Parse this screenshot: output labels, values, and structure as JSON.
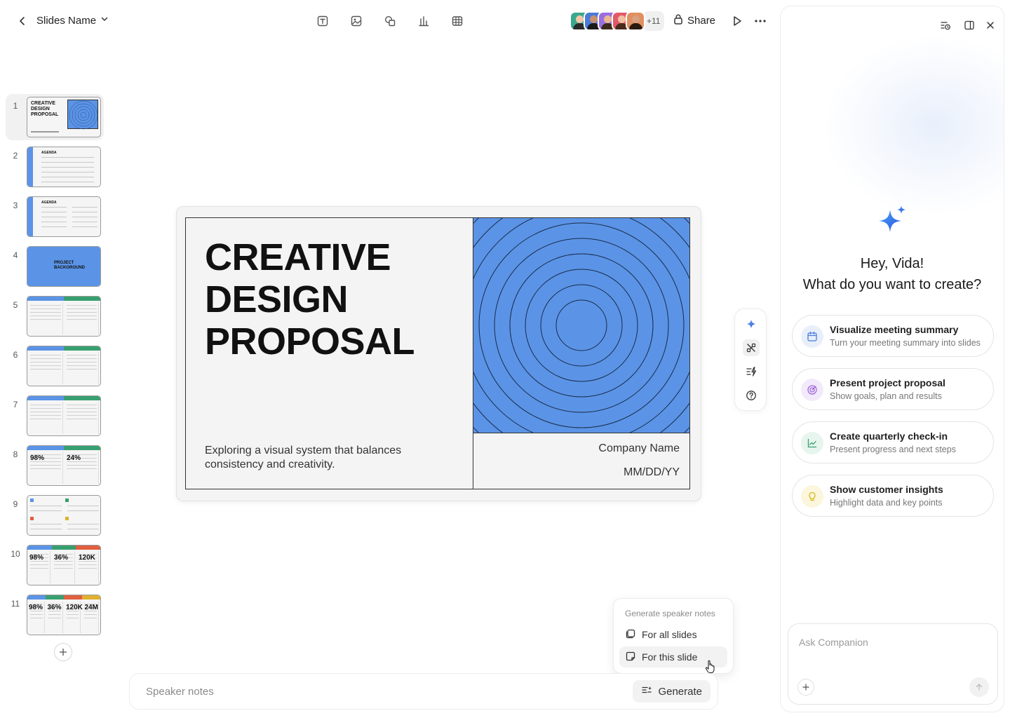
{
  "header": {
    "slides_name": "Slides Name",
    "extra_collaborators": "+11",
    "share_label": "Share",
    "avatar_colors": [
      "#3aa88c",
      "#4a7bd8",
      "#9a6ee0",
      "#e05a6a",
      "#e09060"
    ]
  },
  "toolbar": {
    "icons": [
      "text-box-icon",
      "image-icon",
      "shapes-icon",
      "chart-icon",
      "table-icon"
    ]
  },
  "slides": [
    {
      "num": "1",
      "kind": "title",
      "title": "CREATIVE DESIGN PROPOSAL"
    },
    {
      "num": "2",
      "kind": "agenda",
      "title": "AGENDA"
    },
    {
      "num": "3",
      "kind": "agenda2",
      "title": "AGENDA"
    },
    {
      "num": "4",
      "kind": "background",
      "title": "PROJECT BACKGROUND"
    },
    {
      "num": "5",
      "kind": "two-col"
    },
    {
      "num": "6",
      "kind": "two-col"
    },
    {
      "num": "7",
      "kind": "two-col"
    },
    {
      "num": "8",
      "kind": "stats2",
      "values": [
        "98%",
        "24%"
      ]
    },
    {
      "num": "9",
      "kind": "quad"
    },
    {
      "num": "10",
      "kind": "stats3",
      "values": [
        "98%",
        "36%",
        "120K"
      ]
    },
    {
      "num": "11",
      "kind": "stats4",
      "values": [
        "98%",
        "36%",
        "120K",
        "24M"
      ]
    }
  ],
  "main_slide": {
    "title_lines": [
      "CREATIVE",
      "DESIGN",
      "PROPOSAL"
    ],
    "subtitle": "Exploring a visual system that balances consistency and creativity.",
    "company": "Company Name",
    "date": "MM/DD/YY",
    "accent_color": "#5b94e6"
  },
  "notes": {
    "placeholder": "Speaker notes",
    "generate_label": "Generate"
  },
  "notes_menu": {
    "header": "Generate speaker notes",
    "for_all": "For all slides",
    "for_this": "For this slide"
  },
  "companion": {
    "greeting": "Hey, Vida!",
    "question": "What do you want to create?",
    "cards": [
      {
        "title": "Visualize meeting summary",
        "subtitle": "Turn your meeting summary into slides",
        "icon": "calendar-icon",
        "color": "#4a7bd8",
        "bg": "#e8effb"
      },
      {
        "title": "Present project proposal",
        "subtitle": "Show goals, plan and results",
        "icon": "target-icon",
        "color": "#a068d8",
        "bg": "#f2eafb"
      },
      {
        "title": "Create quarterly check-in",
        "subtitle": "Present progress and next steps",
        "icon": "trend-chart-icon",
        "color": "#3aa070",
        "bg": "#e6f5ed"
      },
      {
        "title": "Show customer insights",
        "subtitle": "Highlight data and key points",
        "icon": "lightbulb-icon",
        "color": "#d8b820",
        "bg": "#fbf6dc"
      }
    ],
    "ask_placeholder": "Ask Companion"
  }
}
